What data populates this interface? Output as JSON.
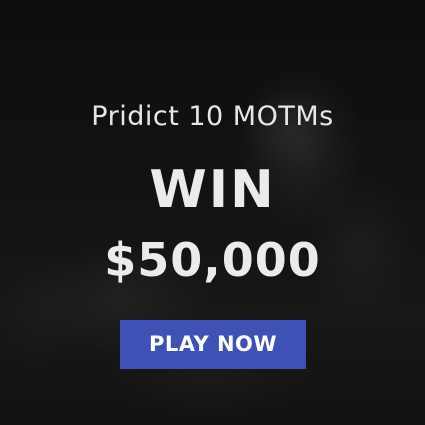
{
  "banner": {
    "headline": "Pridict 10 MOTMs",
    "win_label": "WIN",
    "prize": "$50,000",
    "cta_label": "PLAY NOW",
    "cta_color": "#3f51b5"
  }
}
